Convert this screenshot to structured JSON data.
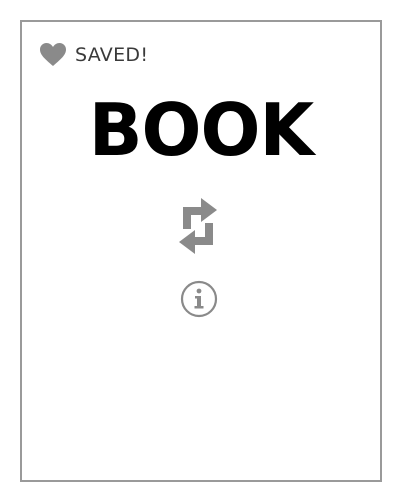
{
  "status": {
    "saved_label": "SAVED!",
    "icon": "heart-icon"
  },
  "card": {
    "word": "BOOK"
  },
  "actions": {
    "swap_icon": "swap-arrows-icon",
    "info_icon": "info-icon"
  },
  "colors": {
    "icon_gray": "#8a8a8a",
    "border_gray": "#9a9a9a",
    "text_black": "#000000",
    "label_dark": "#3a3a3a"
  }
}
